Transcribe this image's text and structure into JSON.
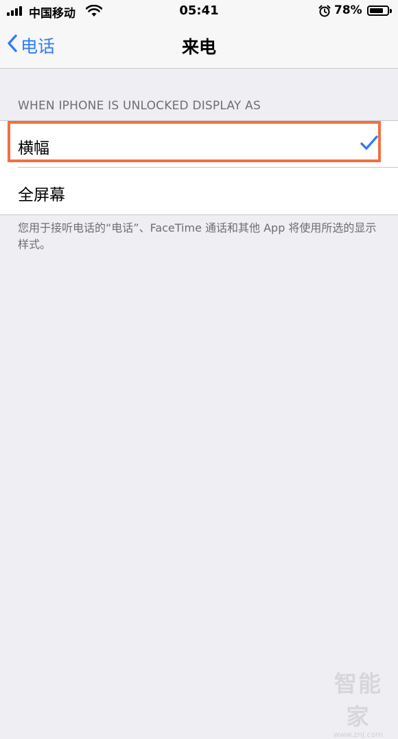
{
  "status_bar": {
    "carrier": "中国移动",
    "time": "05:41",
    "battery_percent_text": "78%",
    "battery_level": 0.78,
    "icons": [
      "signal-icon",
      "wifi-icon",
      "alarm-icon",
      "battery-icon"
    ]
  },
  "nav": {
    "back_label": "电话",
    "title": "来电"
  },
  "section": {
    "header": "WHEN IPHONE IS UNLOCKED DISPLAY AS",
    "options": [
      {
        "label": "横幅",
        "selected": true
      },
      {
        "label": "全屏幕",
        "selected": false
      }
    ],
    "footer": "您用于接听电话的“电话”、FaceTime 通话和其他 App 将使用所选的显示样式。"
  },
  "colors": {
    "accent": "#2f7cf6",
    "highlight": "#f26f41",
    "background": "#efeef3"
  },
  "watermark": {
    "brand": "智能家",
    "url": "www.znj.com"
  }
}
